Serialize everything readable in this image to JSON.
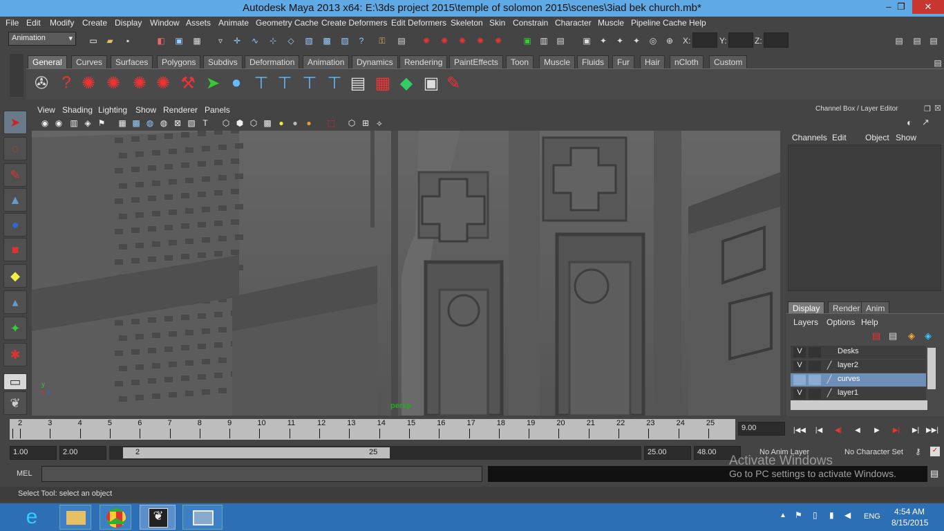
{
  "title": "Autodesk Maya 2013 x64: E:\\3ds project 2015\\temple of solomon 2015\\scenes\\3iad bek church.mb*",
  "window_controls": {
    "minimize": "–",
    "restore": "❐",
    "close": "✕"
  },
  "menu": [
    "File",
    "Edit",
    "Modify",
    "Create",
    "Display",
    "Window",
    "Assets",
    "Animate",
    "Geometry Cache",
    "Create Deformers",
    "Edit Deformers",
    "Skeleton",
    "Skin",
    "Constrain",
    "Character",
    "Muscle",
    "Pipeline Cache",
    "Help"
  ],
  "statusline": {
    "menu_set": "Animation",
    "x_label": "X:",
    "y_label": "Y:",
    "z_label": "Z:"
  },
  "shelf_tabs": [
    "General",
    "Curves",
    "Surfaces",
    "Polygons",
    "Subdivs",
    "Deformation",
    "Animation",
    "Dynamics",
    "Rendering",
    "PaintEffects",
    "Toon",
    "Muscle",
    "Fluids",
    "Fur",
    "Hair",
    "nCloth",
    "Custom"
  ],
  "panel_menu": [
    "View",
    "Shading",
    "Lighting",
    "Show",
    "Renderer",
    "Panels"
  ],
  "viewport": {
    "camera_label": "persp"
  },
  "channel_box": {
    "title": "Channel Box / Layer Editor",
    "menu": [
      "Channels",
      "Edit",
      "Object",
      "Show"
    ]
  },
  "layer_editor": {
    "tabs": [
      "Display",
      "Render",
      "Anim"
    ],
    "menu": [
      "Layers",
      "Options",
      "Help"
    ],
    "layers": [
      {
        "v": "V",
        "name": "Desks"
      },
      {
        "v": "V",
        "name": "layer2"
      },
      {
        "v": "",
        "name": "curves"
      },
      {
        "v": "V",
        "name": "layer1"
      }
    ]
  },
  "timeline": {
    "ticks": [
      "2",
      "3",
      "4",
      "5",
      "6",
      "7",
      "8",
      "9",
      "10",
      "11",
      "12",
      "13",
      "14",
      "15",
      "16",
      "17",
      "18",
      "19",
      "20",
      "21",
      "22",
      "23",
      "24",
      "25"
    ],
    "current_frame": "9.00"
  },
  "range": {
    "start": "1.00",
    "inner_start": "2.00",
    "slider_start": "2",
    "slider_end": "25",
    "inner_end": "25.00",
    "end": "48.00",
    "anim_layer": "No Anim Layer",
    "char_set": "No Character Set"
  },
  "cmdline": {
    "label": "MEL"
  },
  "watermark": {
    "line1": "Activate Windows",
    "line2": "Go to PC settings to activate Windows."
  },
  "helpline": "Select Tool: select an object",
  "taskbar": {
    "lang": "ENG",
    "time": "4:54 AM",
    "date": "8/15/2015"
  }
}
